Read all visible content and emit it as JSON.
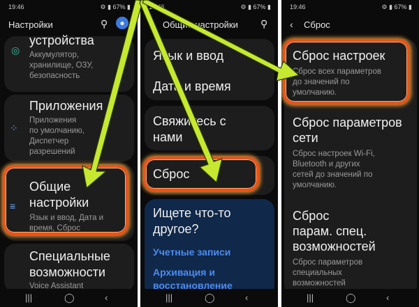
{
  "status": {
    "time": "19:46",
    "battery": "67%"
  },
  "screen1": {
    "title": "Настройки",
    "device_title_partial": "устройства",
    "device_sub": [
      "Аккумулятор,",
      "хранилище, ОЗУ,",
      "безопасность"
    ],
    "apps_title": "Приложения",
    "apps_sub": [
      "Приложения",
      "по умолчанию,",
      "Диспетчер",
      "разрешений"
    ],
    "general_title": [
      "Общие",
      "настройки"
    ],
    "general_sub": [
      "Язык и ввод, Дата и",
      "время, Сброс"
    ],
    "access_title": [
      "Специальные",
      "возможности"
    ],
    "access_sub_partial": "Voice Assistant"
  },
  "screen2": {
    "title": "Общие настройки",
    "items": [
      "Язык и ввод",
      "Дата и время",
      "Свяжитесь с",
      "нами",
      "Сброс"
    ],
    "help_title": [
      "Ищете что-то",
      "другое?"
    ],
    "help_links": [
      "Учетные записи",
      "Архивация и",
      "восстановление"
    ]
  },
  "screen3": {
    "title": "Сброс",
    "reset_settings_title": "Сброс настроек",
    "reset_settings_sub": [
      "Сброс всех параметров",
      "до значений по",
      "умолчанию."
    ],
    "reset_network_title": [
      "Сброс параметров",
      "сети"
    ],
    "reset_network_sub": [
      "Сброс настроек Wi-Fi,",
      "Bluetooth и других",
      "сетей до значений по",
      "умолчанию."
    ],
    "reset_access_title": [
      "Сброс",
      "парам. спец.",
      "возможностей"
    ],
    "reset_access_sub": [
      "Сброс параметров",
      "специальных",
      "возможностей"
    ]
  },
  "colors": {
    "highlight": "#e8541a",
    "arrow": "#c6e830",
    "link": "#4a8cf0",
    "help_bg": "#10284a"
  }
}
